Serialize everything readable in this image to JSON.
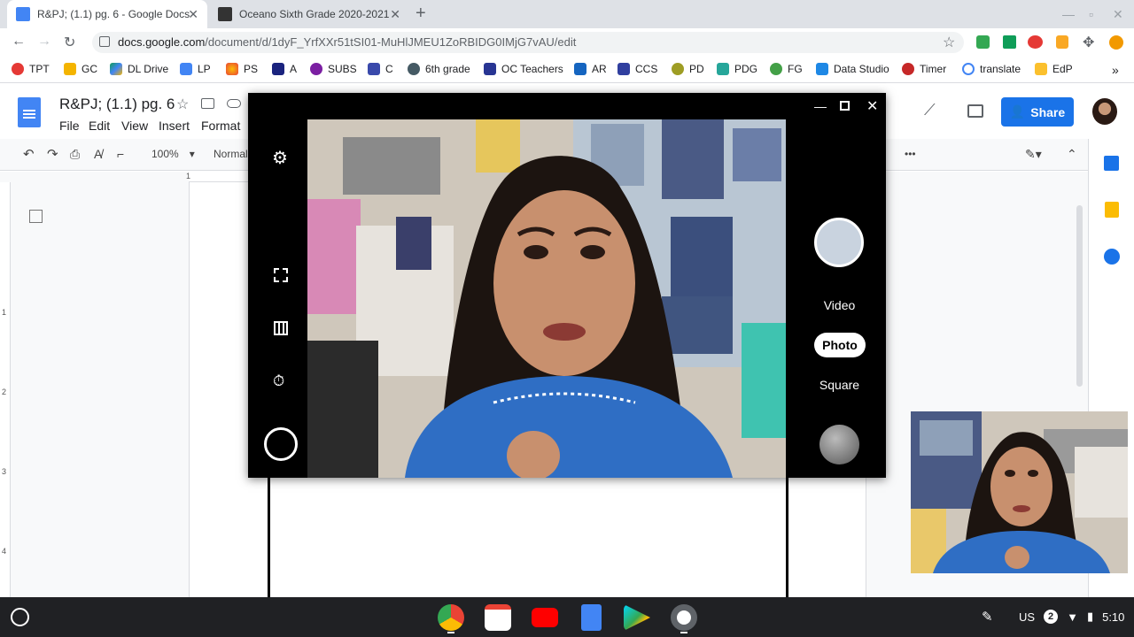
{
  "tabs": [
    {
      "title": "R&PJ; (1.1) pg. 6 - Google Docs",
      "active": true
    },
    {
      "title": "Oceano Sixth Grade 2020-2021",
      "active": false
    }
  ],
  "new_tab": "+",
  "address": {
    "host": "docs.google.com",
    "path": "/document/d/1dyF_YrfXXr51tSI01-MuHlJMEU1ZoRBIDG0IMjG7vAU/edit"
  },
  "bookmarks": [
    "TPT",
    "GC",
    "DL Drive",
    "LP",
    "PS",
    "A",
    "SUBS",
    "C",
    "6th grade",
    "OC Teachers",
    "AR",
    "CCS",
    "PD",
    "PDG",
    "FG",
    "Data Studio",
    "Timer",
    "translate",
    "EdP"
  ],
  "bookmarks_more": "»",
  "doc": {
    "title": "R&PJ; (1.1) pg. 6",
    "menus": [
      "File",
      "Edit",
      "View",
      "Insert",
      "Format"
    ],
    "share": "Share",
    "zoom": "100%",
    "style": "Normal",
    "more": "•••",
    "ruler_top": "1",
    "ruler_left": [
      "1",
      "2",
      "3",
      "4"
    ]
  },
  "camera": {
    "modes": [
      "Video",
      "Photo",
      "Square"
    ],
    "active_mode": "Photo"
  },
  "shelf": {
    "ime": "US",
    "notifications": "2",
    "time": "5:10"
  },
  "colors": {
    "accent": "#1a73e8",
    "tabstrip": "#dee1e6",
    "shelf": "#202124"
  }
}
